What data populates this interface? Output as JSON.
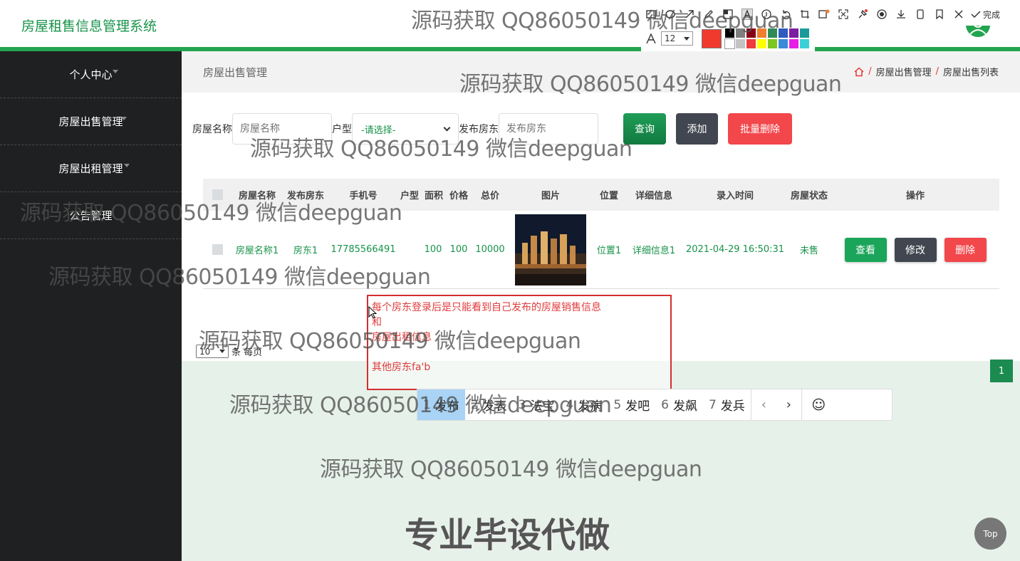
{
  "app": {
    "title": "房屋租售信息管理系统"
  },
  "sidebar": {
    "items": [
      {
        "label": "个人中心"
      },
      {
        "label": "房屋出售管理"
      },
      {
        "label": "房屋出租管理"
      },
      {
        "label": "公告管理"
      }
    ]
  },
  "page": {
    "title": "房屋出售管理",
    "breadcrumb": [
      "房屋出售管理",
      "房屋出售列表"
    ],
    "breadcrumb_separator": "/"
  },
  "search": {
    "name_label": "房屋名称",
    "name_placeholder": "房屋名称",
    "type_label": "户型",
    "type_value": "-请选择-",
    "landlord_label": "发布房东",
    "landlord_placeholder": "发布房东",
    "query_button": "查询",
    "add_button": "添加",
    "batch_delete_button": "批量删除"
  },
  "table": {
    "headers": [
      "房屋名称",
      "发布房东",
      "手机号",
      "户型",
      "面积",
      "价格",
      "总价",
      "图片",
      "位置",
      "详细信息",
      "录入时间",
      "房屋状态",
      "操作"
    ],
    "rows": [
      {
        "name": "房屋名称1",
        "landlord": "房东1",
        "phone": "17785566491",
        "type": "",
        "area": "100",
        "price": "100",
        "total": "10000",
        "location": "位置1",
        "detail": "详细信息1",
        "time": "2021-04-29 16:50:31",
        "status": "未售",
        "actions": [
          "查看",
          "修改",
          "删除"
        ]
      }
    ]
  },
  "pagination": {
    "page_size": "10",
    "per_page_label": "条 每页",
    "current_page": "1"
  },
  "annotation": {
    "text": "每个房东登录后是只能看到自己发布的房屋销售信息\n和\n房屋出租信息\n\n其他房东fa'b"
  },
  "toolbar": {
    "font_size": "12",
    "done_label": "完成",
    "current_color": "#f03a2e",
    "palette": [
      "#000000",
      "#7f7f7f",
      "#880015",
      "#f07f2e",
      "#2e8b57",
      "#2e5bbd",
      "#7a1fa2",
      "#1a9a9a",
      "#ffffff",
      "#c3c3c3",
      "#ef3b3b",
      "#ffff00",
      "#7dc61e",
      "#3b8ad8",
      "#e61ee6",
      "#3ad0d8"
    ]
  },
  "ime": {
    "candidates": [
      {
        "num": "1",
        "text": "发布"
      },
      {
        "num": "2",
        "text": "发表"
      },
      {
        "num": "3",
        "text": "法宝"
      },
      {
        "num": "4",
        "text": "发病"
      },
      {
        "num": "5",
        "text": "发吧"
      },
      {
        "num": "6",
        "text": "发飙"
      },
      {
        "num": "7",
        "text": "发兵"
      }
    ]
  },
  "watermark": "源码获取 QQ86050149 微信deepguan",
  "promo": "专业毕设代做",
  "back_to_top": "Top",
  "colors": {
    "brand_green": "#17934a",
    "sidebar_bg": "#1f2021",
    "danger": "#f2474b",
    "dark_button": "#424650"
  }
}
